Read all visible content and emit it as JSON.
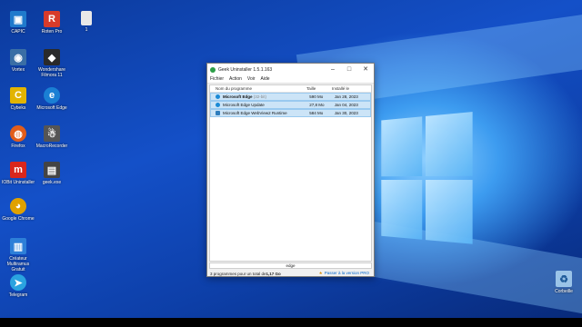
{
  "desktop": {
    "icons": [
      {
        "label": "CAPIC",
        "icon": "capic-icon",
        "color": "#1f7acc",
        "glyph": "▣"
      },
      {
        "label": "Roten Pro",
        "icon": "roten-pro-icon",
        "color": "#d83b2b",
        "glyph": "R"
      },
      {
        "label": "1",
        "icon": "file-icon",
        "color": "#e8e8e8",
        "glyph": ""
      },
      {
        "label": "Vortex",
        "icon": "vortex-icon",
        "color": "#3a6ea5",
        "glyph": "◉"
      },
      {
        "label": "Wondershare Filmora 11",
        "icon": "filmora-icon",
        "color": "#2a2a2a",
        "glyph": "◆"
      },
      {
        "label": "Cybeks",
        "icon": "cybeks-icon",
        "color": "#e2b400",
        "glyph": "C"
      },
      {
        "label": "Microsoft Edge",
        "icon": "edge-icon",
        "color": "#1a7fd4",
        "glyph": "e"
      },
      {
        "label": "Firefox",
        "icon": "firefox-icon",
        "color": "#e25d1b",
        "glyph": "◍"
      },
      {
        "label": "MacroRecorder",
        "icon": "macrorecorder-icon",
        "color": "#555",
        "glyph": "☃"
      },
      {
        "label": "IOBit Uninstaller",
        "icon": "iobit-icon",
        "color": "#d9261c",
        "glyph": "m"
      },
      {
        "label": "geek.exe",
        "icon": "geek-exe-icon",
        "color": "#444",
        "glyph": "▤"
      },
      {
        "label": "Google Chrome",
        "icon": "chrome-icon",
        "color": "#e0a100",
        "glyph": "◕"
      },
      {
        "label": "Créateur Multiramus Gratuit",
        "icon": "multiramus-icon",
        "color": "#2d7fd8",
        "glyph": "▥"
      },
      {
        "label": "Telegram",
        "icon": "telegram-icon",
        "color": "#2aa3e0",
        "glyph": "➤"
      },
      {
        "label": "Corbeille",
        "icon": "recycle-bin-icon",
        "color": "#9ac4e8",
        "glyph": "♻"
      }
    ]
  },
  "window": {
    "title": "Geek Uninstaller 1.5.1.163",
    "min": "–",
    "max": "□",
    "close": "✕",
    "menu": [
      "Fichier",
      "Action",
      "Voir",
      "Aide"
    ],
    "columns": {
      "name": "Nom du programme",
      "size": "Taille",
      "date": "Installé le"
    },
    "rows": [
      {
        "name": "Microsoft Edge",
        "extra": " (32-bit)",
        "size": "590 Mo",
        "date": "Jan 28, 2023",
        "color": "#1b8ad6"
      },
      {
        "name": "Microsoft Edge Update",
        "extra": "",
        "size": "27,8 Mo",
        "date": "Jan 04, 2023",
        "color": "#1b8ad6"
      },
      {
        "name": "Microsoft Edge WebView2 Runtime",
        "extra": "",
        "size": "584 Mo",
        "date": "Jan 30, 2023",
        "color": "#2e7dbd"
      }
    ],
    "search": "edge",
    "status_prefix": "3 programmes pour un total de ",
    "status_total": "1,17 Go",
    "promo": "Passer à la version PRO"
  }
}
